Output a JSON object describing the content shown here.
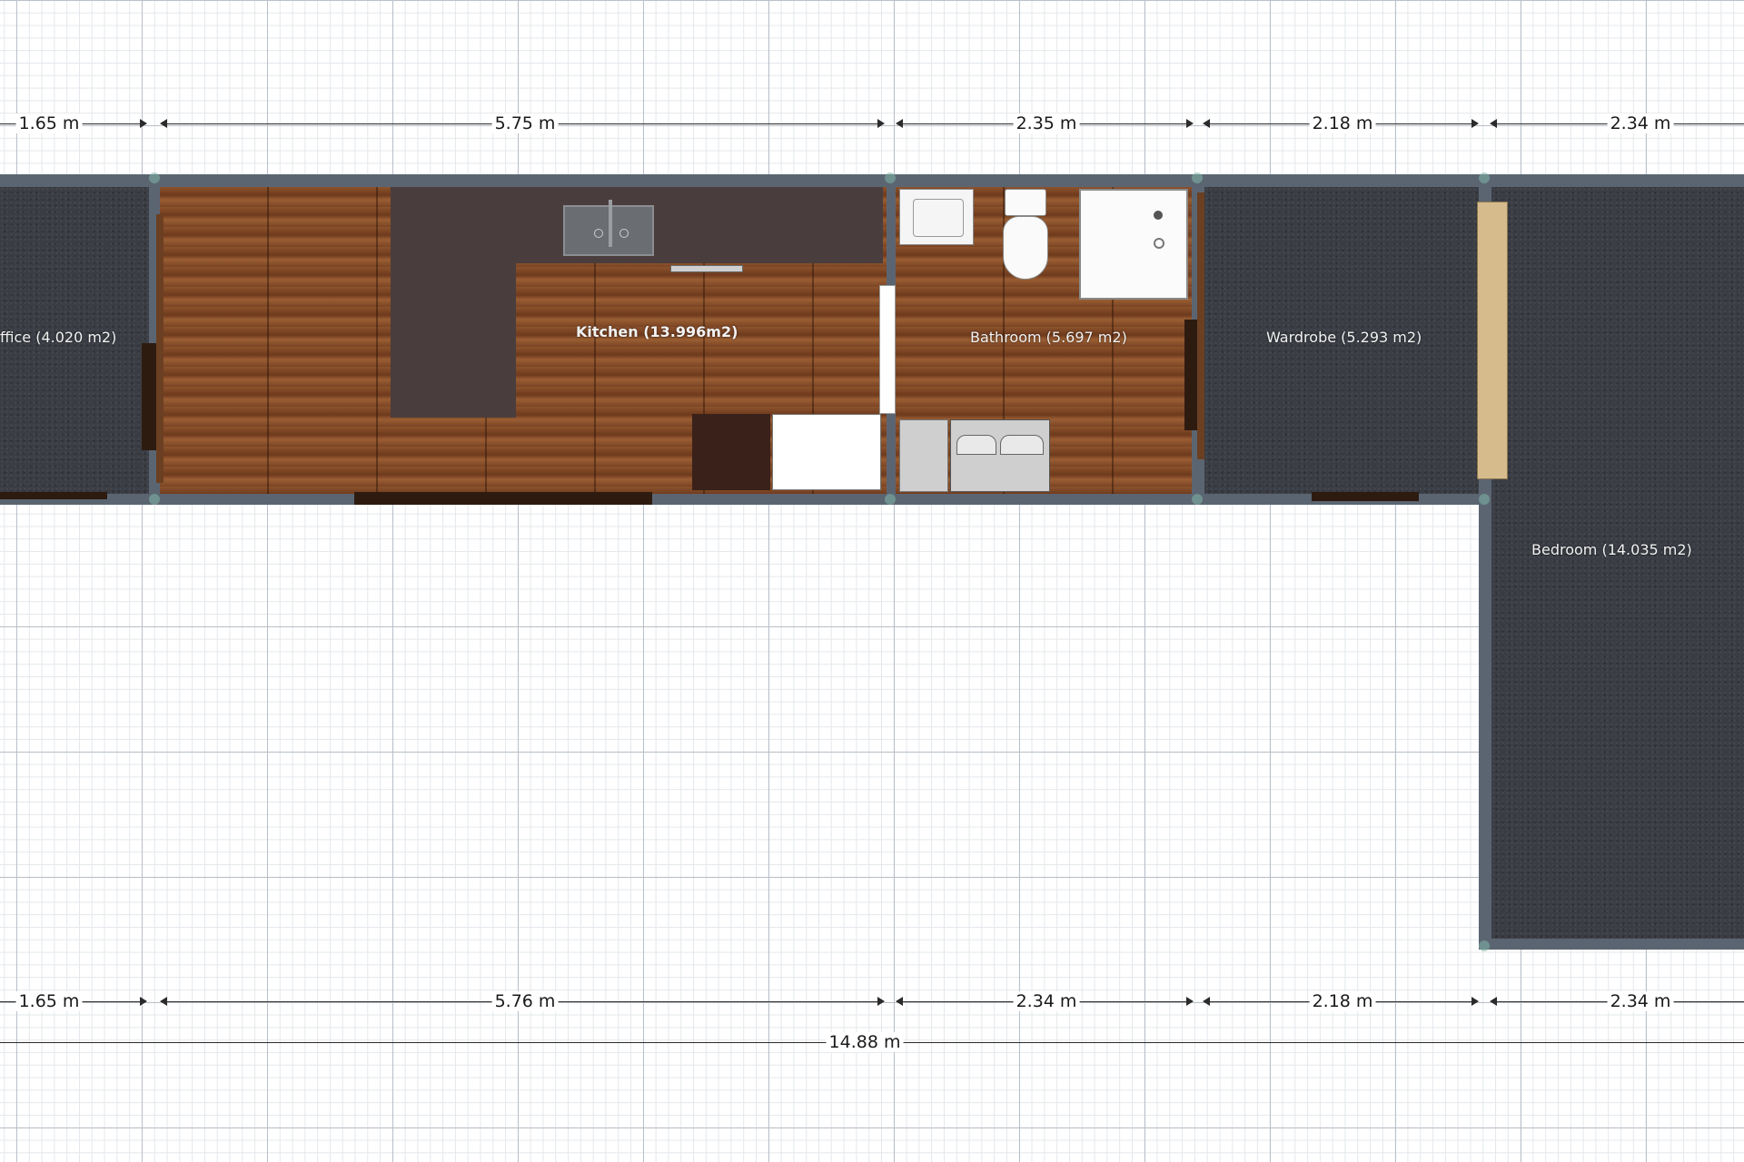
{
  "rooms": {
    "office": {
      "label": "ffice (4.020 m2)"
    },
    "kitchen": {
      "label": "Kitchen    (13.996m2)"
    },
    "bathroom": {
      "label": "Bathroom (5.697 m2)"
    },
    "wardrobe": {
      "label": "Wardrobe (5.293 m2)"
    },
    "bedroom": {
      "label": "Bedroom (14.035 m2)"
    }
  },
  "dimensions": {
    "top": [
      "1.65 m",
      "5.75 m",
      "2.35 m",
      "2.18 m",
      "2.34 m"
    ],
    "bottom": [
      "1.65 m",
      "5.76 m",
      "2.34 m",
      "2.18 m",
      "2.34 m"
    ],
    "total": "14.88 m"
  },
  "colors": {
    "wall": "#5b6572",
    "carpet": "#3a3d44",
    "wood_floor": "#7a4424",
    "countertop": "#4a3d3d"
  },
  "icons": [
    "kitchen-sink-icon",
    "bathroom-sink-icon",
    "toilet-icon",
    "shower-icon",
    "bathtub-icon",
    "stove-icon",
    "fridge-icon"
  ]
}
